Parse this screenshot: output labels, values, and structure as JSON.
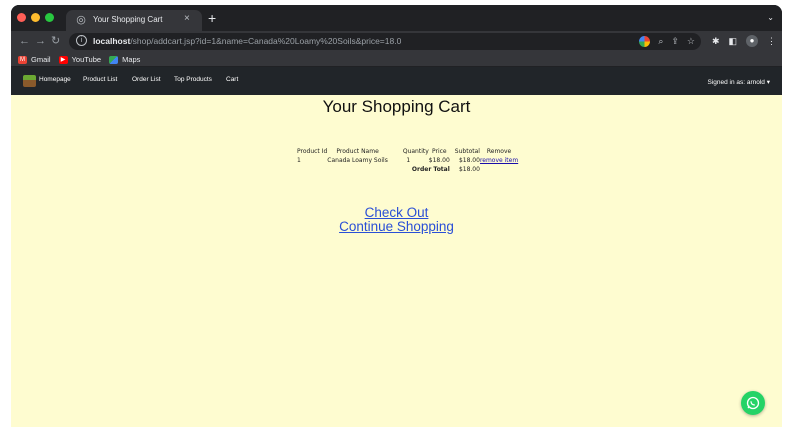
{
  "browser": {
    "tab_title": "Your Shopping Cart",
    "tab_close": "×",
    "new_tab": "+",
    "tab_menu": "⌄",
    "url_host": "localhost",
    "url_path": "/shop/addcart.jsp?id=1&name=Canada%20Loamy%20Soils&price=18.0",
    "bookmarks": [
      {
        "label": "Gmail",
        "icon": "gmail-icon"
      },
      {
        "label": "YouTube",
        "icon": "youtube-icon"
      },
      {
        "label": "Maps",
        "icon": "maps-icon"
      }
    ]
  },
  "nav": {
    "links": [
      "Homepage",
      "Product List",
      "Order List",
      "Top Products",
      "Cart"
    ],
    "signed_in": "Signed in as: arnold ▾"
  },
  "page": {
    "title": "Your Shopping Cart",
    "table": {
      "headers": [
        "Product Id",
        "Product Name",
        "Quantity",
        "Price",
        "Subtotal",
        "Remove"
      ],
      "rows": [
        {
          "id": "1",
          "name": "Canada Loamy Soils",
          "quantity": "1",
          "price": "$18.00",
          "subtotal": "$18.00",
          "remove": "remove item"
        }
      ],
      "total_label": "Order Total",
      "total_value": "$18.00"
    },
    "checkout_label": "Check Out",
    "continue_label": "Continue Shopping"
  },
  "colors": {
    "page_bg": "#fefcd0",
    "navbar_bg": "#212529",
    "link": "#2a4fd6",
    "whatsapp": "#25d366"
  }
}
